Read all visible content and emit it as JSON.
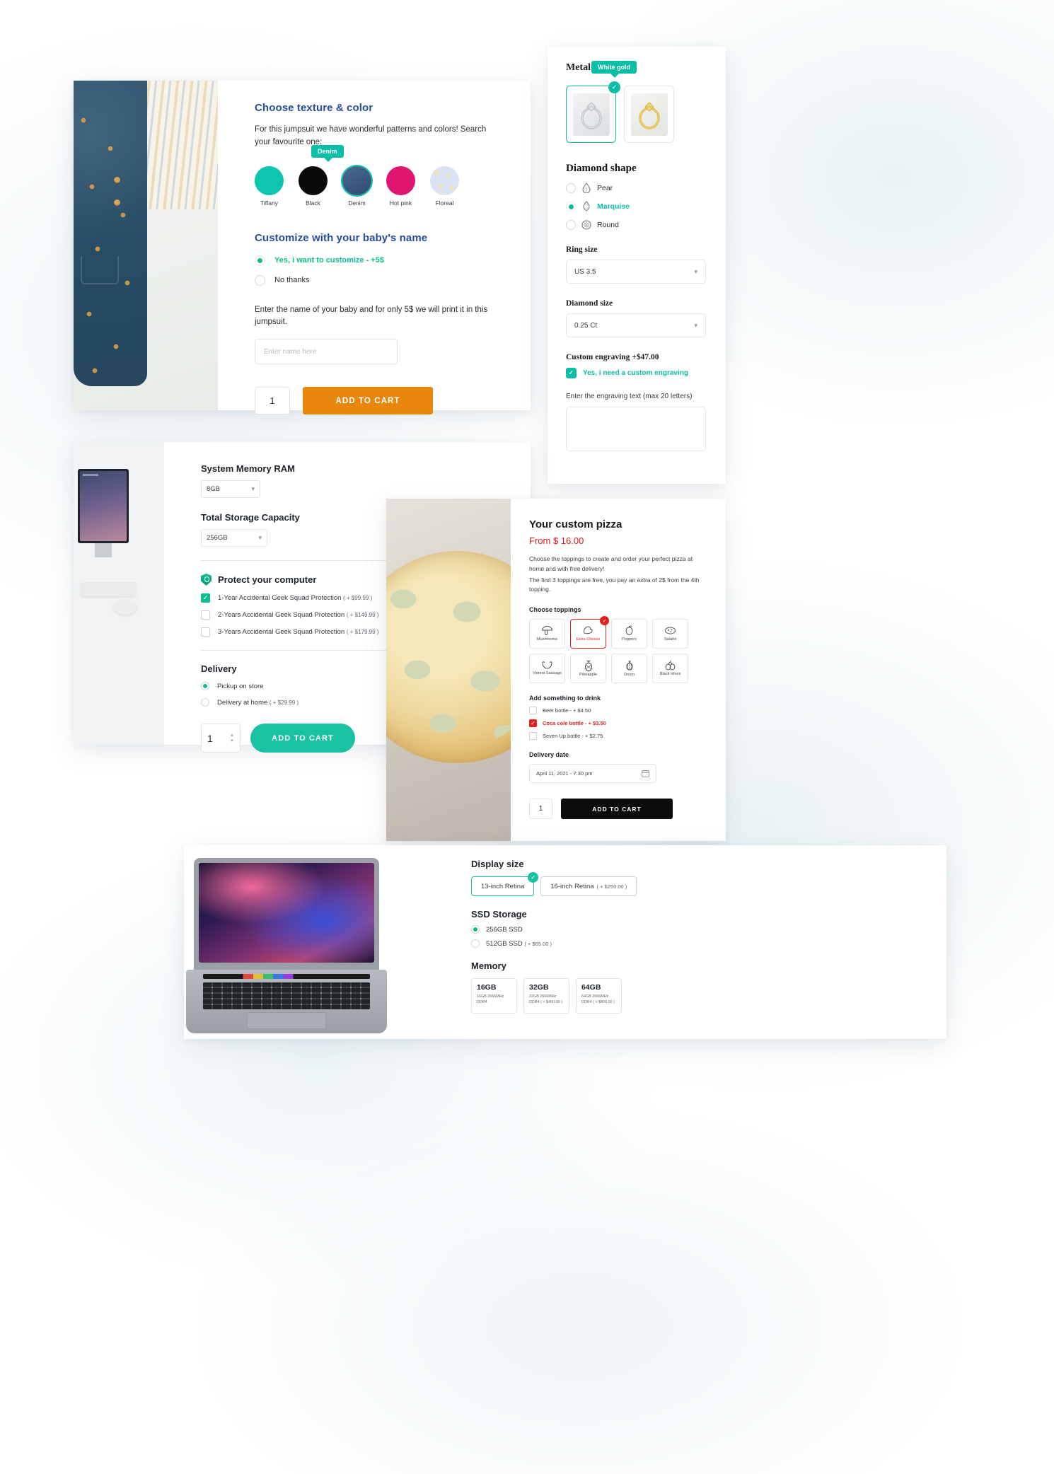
{
  "jumpsuit": {
    "heading1": "Choose texture & color",
    "desc": "For this jumpsuit we have wonderful patterns and colors! Search your favourite one:",
    "tooltip": "Denim",
    "swatches": [
      {
        "label": "Tiffany",
        "color": "#0bc5ad",
        "selected": false
      },
      {
        "label": "Black",
        "color": "#0a0a0a",
        "selected": false
      },
      {
        "label": "Denim",
        "color": "#3a5a82",
        "selected": true
      },
      {
        "label": "Hot pink",
        "color": "#e0156f",
        "selected": false
      },
      {
        "label": "Floreal",
        "color": "#dbe3f2",
        "selected": false
      }
    ],
    "heading2": "Customize with your baby's name",
    "radios": [
      {
        "label": "Yes, i want to customize - +5$",
        "selected": true
      },
      {
        "label": "No thanks",
        "selected": false
      }
    ],
    "name_hint": "Enter the name of your baby and for only 5$ we will print it in this jumpsuit.",
    "name_placeholder": "Enter name here",
    "quantity": "1",
    "add_to_cart": "ADD TO CART"
  },
  "ring": {
    "title": "Metal color",
    "tooltip": "White gold",
    "metals": [
      {
        "name": "White gold",
        "selected": true
      },
      {
        "name": "Yellow gold",
        "selected": false
      }
    ],
    "shape_heading": "Diamond shape",
    "shapes": [
      {
        "label": "Pear",
        "selected": false
      },
      {
        "label": "Marquise",
        "selected": true
      },
      {
        "label": "Round",
        "selected": false
      }
    ],
    "ring_size_label": "Ring size",
    "ring_size_value": "US 3.5",
    "diamond_size_label": "Diamond size",
    "diamond_size_value": "0.25 Ct",
    "engraving_heading": "Custom engraving +$47.00",
    "engraving_checkbox": "Yes, i need a custom engraving",
    "engraving_checked": true,
    "engraving_hint": "Enter the engraving text (max 20 letters)",
    "engraving_value": ""
  },
  "computer": {
    "ram_label": "System Memory RAM",
    "ram_value": "8GB",
    "storage_label": "Total Storage Capacity",
    "storage_value": "256GB",
    "protect_label": "Protect your computer",
    "protection": [
      {
        "label": "1-Year Accidental Geek Squad Protection",
        "price": "( + $99.99 )",
        "checked": true
      },
      {
        "label": "2-Years Accidental Geek Squad Protection",
        "price": "( + $149.99 )",
        "checked": false
      },
      {
        "label": "3-Years Accidental Geek Squad Protection",
        "price": "( + $179.99 )",
        "checked": false
      }
    ],
    "delivery_label": "Delivery",
    "delivery": [
      {
        "label": "Pickup on store",
        "price": "",
        "selected": true
      },
      {
        "label": "Delivery at home",
        "price": "( + $29.99 )",
        "selected": false
      }
    ],
    "quantity": "1",
    "add_to_cart": "ADD TO CART"
  },
  "pizza": {
    "title": "Your custom pizza",
    "price": "From $ 16.00",
    "desc_line1": "Choose the toppings to create and order your perfect pizza at home and with free delivery!",
    "desc_line2": "The first 3 toppings are free, you pay an extra of 2$ from the 4th topping.",
    "toppings_heading": "Choose toppings",
    "toppings": [
      {
        "label": "Mushrooms",
        "icon": "mushroom-icon",
        "selected": false
      },
      {
        "label": "Extra Cheese",
        "icon": "cheese-icon",
        "selected": true
      },
      {
        "label": "Peppers",
        "icon": "pepper-icon",
        "selected": false
      },
      {
        "label": "Salami",
        "icon": "salami-icon",
        "selected": false
      },
      {
        "label": "Vienna Sausage",
        "icon": "sausage-icon",
        "selected": false
      },
      {
        "label": "Pineapple",
        "icon": "pineapple-icon",
        "selected": false
      },
      {
        "label": "Onion",
        "icon": "onion-icon",
        "selected": false
      },
      {
        "label": "Black olives",
        "icon": "olives-icon",
        "selected": false
      }
    ],
    "drinks_heading": "Add something to drink",
    "drinks": [
      {
        "label": "Beer bottle - + $4.50",
        "checked": false
      },
      {
        "label": "Coca cole bottle - + $3.50",
        "checked": true
      },
      {
        "label": "Seven Up bottle - + $2.75",
        "checked": false
      }
    ],
    "date_label": "Delivery date",
    "date_value": "April 11, 2021 - 7:30 pm",
    "quantity": "1",
    "add_to_cart": "ADD TO CART"
  },
  "macbook": {
    "display_label": "Display size",
    "display_options": [
      {
        "label": "13-inch Retina",
        "price": "",
        "selected": true
      },
      {
        "label": "16-inch Retina",
        "price": "( + $250.00 )",
        "selected": false
      }
    ],
    "ssd_label": "SSD Storage",
    "ssd_options": [
      {
        "label": "256GB SSD",
        "price": "",
        "selected": true
      },
      {
        "label": "512GB SSD",
        "price": "( + $65.00 )",
        "selected": false
      }
    ],
    "memory_label": "Memory",
    "memory_options": [
      {
        "title": "16GB",
        "sub": "16GB 2666MHz DDR4"
      },
      {
        "title": "32GB",
        "sub": "32GB 2666MHz DDR4 ( + $400.00 )"
      },
      {
        "title": "64GB",
        "sub": "64GB 2666MHz DDR4 ( + $800.00 )"
      }
    ]
  },
  "icons": {
    "check": "✓",
    "chevron_down": "⌄",
    "calendar": "Ὄ5",
    "arrow_up": "▲",
    "arrow_down": "▼"
  },
  "colors": {
    "teal": "#0bbfa6",
    "green": "#0bbf90",
    "orange": "#e8870c",
    "red": "#e2211c",
    "blue": "#274d9d",
    "black": "#0c0c0c"
  }
}
